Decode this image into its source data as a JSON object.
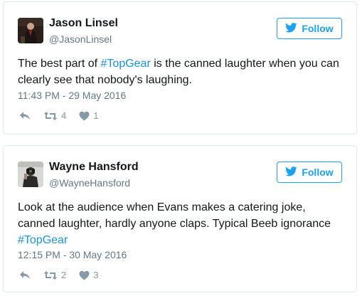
{
  "follow_label": "Follow",
  "colors": {
    "accent": "#1da1f2",
    "hashtag": "#1b95e0",
    "secondary_text": "#657786",
    "action_icon": "#8899a6",
    "border": "#e1e8ed"
  },
  "tweets": [
    {
      "name": "Jason Linsel",
      "handle": "@JasonLinsel",
      "text_before": "The best part of ",
      "hashtag": "#TopGear",
      "text_after": " is the canned laughter when you can clearly see that nobody's laughing.",
      "timestamp": "11:43 PM - 29 May 2016",
      "retweets": "4",
      "likes": "1"
    },
    {
      "name": "Wayne Hansford",
      "handle": "@WayneHansford",
      "text_before": "Look at the audience when Evans makes a catering joke, canned laughter, hardly anyone claps. Typical Beeb ignorance ",
      "hashtag": "#TopGear",
      "text_after": "",
      "timestamp": "12:15 PM - 30 May 2016",
      "retweets": "2",
      "likes": "3"
    }
  ]
}
